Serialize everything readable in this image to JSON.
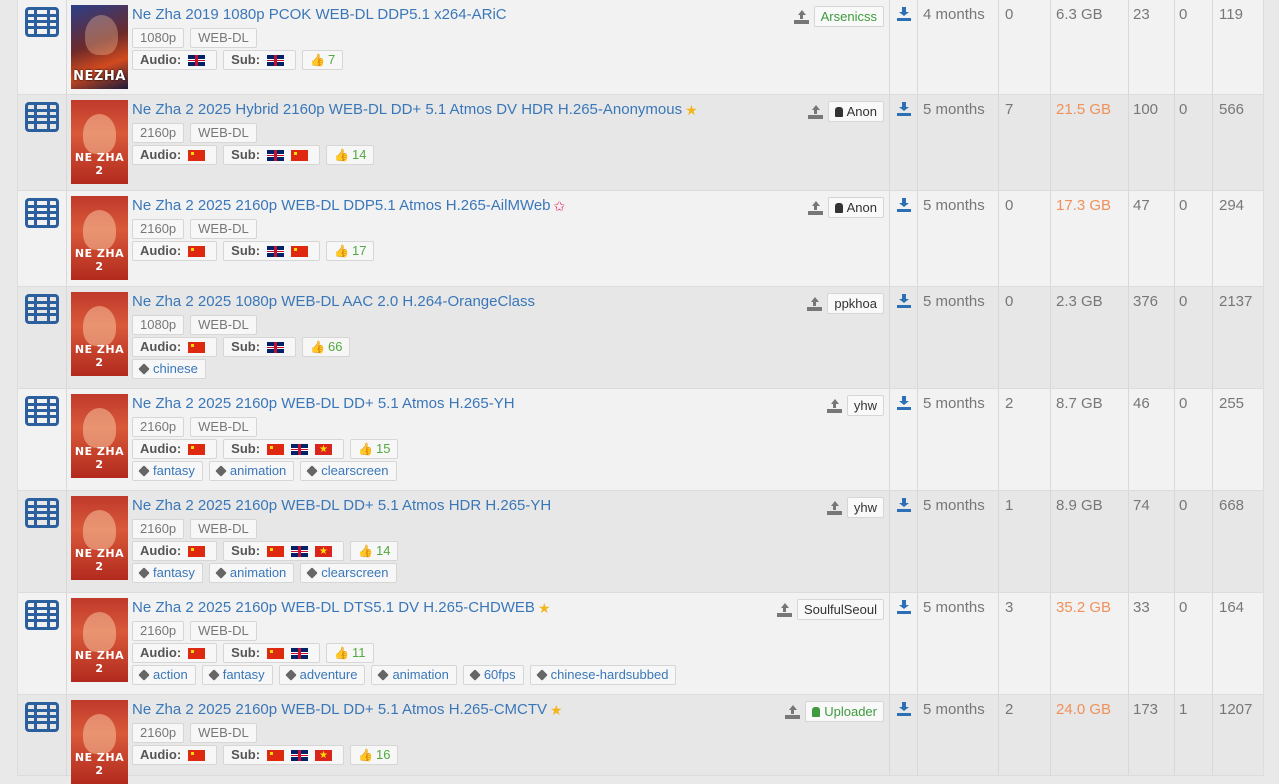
{
  "rows": [
    {
      "title": "Ne Zha 2019 1080p PCOK WEB-DL DDP5.1 x264-ARiC",
      "star": "",
      "poster_text": "NEZHA",
      "resolution": "1080p",
      "source": "WEB-DL",
      "audio_label": "Audio:",
      "audio_flags": [
        "gb"
      ],
      "sub_label": "Sub:",
      "sub_flags": [
        "gb"
      ],
      "likes": "7",
      "genres": [],
      "uploader": "Arsenicss",
      "uploader_style": "green",
      "age": "4 months",
      "comments": "0",
      "size": "6.3 GB",
      "size_highlight": false,
      "seeders": "23",
      "leechers": "0",
      "completed": "119"
    },
    {
      "title": "Ne Zha 2 2025 Hybrid 2160p WEB-DL DD+ 5.1 Atmos DV HDR H.265-Anonymous",
      "star": "gold",
      "poster_text": "NE ZHA 2",
      "resolution": "2160p",
      "source": "WEB-DL",
      "audio_label": "Audio:",
      "audio_flags": [
        "cn"
      ],
      "sub_label": "Sub:",
      "sub_flags": [
        "gb",
        "cn"
      ],
      "likes": "14",
      "genres": [],
      "uploader": "Anon",
      "uploader_style": "anon",
      "age": "5 months",
      "comments": "7",
      "size": "21.5 GB",
      "size_highlight": true,
      "seeders": "100",
      "leechers": "0",
      "completed": "566"
    },
    {
      "title": "Ne Zha 2 2025 2160p WEB-DL DDP5.1 Atmos H.265-AilMWeb",
      "star": "pink",
      "poster_text": "NE ZHA 2",
      "resolution": "2160p",
      "source": "WEB-DL",
      "audio_label": "Audio:",
      "audio_flags": [
        "cn"
      ],
      "sub_label": "Sub:",
      "sub_flags": [
        "gb",
        "cn"
      ],
      "likes": "17",
      "genres": [],
      "uploader": "Anon",
      "uploader_style": "anon",
      "age": "5 months",
      "comments": "0",
      "size": "17.3 GB",
      "size_highlight": true,
      "seeders": "47",
      "leechers": "0",
      "completed": "294"
    },
    {
      "title": "Ne Zha 2 2025 1080p WEB-DL AAC 2.0 H.264-OrangeClass",
      "star": "",
      "poster_text": "NE ZHA 2",
      "resolution": "1080p",
      "source": "WEB-DL",
      "audio_label": "Audio:",
      "audio_flags": [
        "cn"
      ],
      "sub_label": "Sub:",
      "sub_flags": [
        "gb"
      ],
      "likes": "66",
      "genres": [
        "chinese"
      ],
      "uploader": "ppkhoa",
      "uploader_style": "plain",
      "age": "5 months",
      "comments": "0",
      "size": "2.3 GB",
      "size_highlight": false,
      "seeders": "376",
      "leechers": "0",
      "completed": "2137"
    },
    {
      "title": "Ne Zha 2 2025 2160p WEB-DL DD+ 5.1 Atmos H.265-YH",
      "star": "",
      "poster_text": "NE ZHA 2",
      "resolution": "2160p",
      "source": "WEB-DL",
      "audio_label": "Audio:",
      "audio_flags": [
        "cn"
      ],
      "sub_label": "Sub:",
      "sub_flags": [
        "cn",
        "gb",
        "vn"
      ],
      "likes": "15",
      "genres": [
        "fantasy",
        "animation",
        "clearscreen"
      ],
      "uploader": "yhw",
      "uploader_style": "plain",
      "age": "5 months",
      "comments": "2",
      "size": "8.7 GB",
      "size_highlight": false,
      "seeders": "46",
      "leechers": "0",
      "completed": "255"
    },
    {
      "title": "Ne Zha 2 2025 2160p WEB-DL DD+ 5.1 Atmos HDR H.265-YH",
      "star": "",
      "poster_text": "NE ZHA 2",
      "resolution": "2160p",
      "source": "WEB-DL",
      "audio_label": "Audio:",
      "audio_flags": [
        "cn"
      ],
      "sub_label": "Sub:",
      "sub_flags": [
        "cn",
        "gb",
        "vn"
      ],
      "likes": "14",
      "genres": [
        "fantasy",
        "animation",
        "clearscreen"
      ],
      "uploader": "yhw",
      "uploader_style": "plain",
      "age": "5 months",
      "comments": "1",
      "size": "8.9 GB",
      "size_highlight": false,
      "seeders": "74",
      "leechers": "0",
      "completed": "668"
    },
    {
      "title": "Ne Zha 2 2025 2160p WEB-DL DTS5.1 DV H.265-CHDWEB",
      "star": "gold",
      "poster_text": "NE ZHA 2",
      "resolution": "2160p",
      "source": "WEB-DL",
      "audio_label": "Audio:",
      "audio_flags": [
        "cn"
      ],
      "sub_label": "Sub:",
      "sub_flags": [
        "cn",
        "gb"
      ],
      "likes": "11",
      "genres": [
        "action",
        "fantasy",
        "adventure",
        "animation",
        "60fps",
        "chinese-hardsubbed"
      ],
      "uploader": "SoulfulSeoul",
      "uploader_style": "plain",
      "age": "5 months",
      "comments": "3",
      "size": "35.2 GB",
      "size_highlight": true,
      "seeders": "33",
      "leechers": "0",
      "completed": "164"
    },
    {
      "title": "Ne Zha 2 2025 2160p WEB-DL DD+ 5.1 Atmos H.265-CMCTV",
      "star": "gold",
      "poster_text": "NE ZHA 2",
      "resolution": "2160p",
      "source": "WEB-DL",
      "audio_label": "Audio:",
      "audio_flags": [
        "cn"
      ],
      "sub_label": "Sub:",
      "sub_flags": [
        "cn",
        "gb",
        "vn"
      ],
      "likes": "16",
      "genres": [],
      "uploader": "Uploader",
      "uploader_style": "uploader",
      "age": "5 months",
      "comments": "2",
      "size": "24.0 GB",
      "size_highlight": true,
      "seeders": "173",
      "leechers": "1",
      "completed": "1207"
    }
  ]
}
